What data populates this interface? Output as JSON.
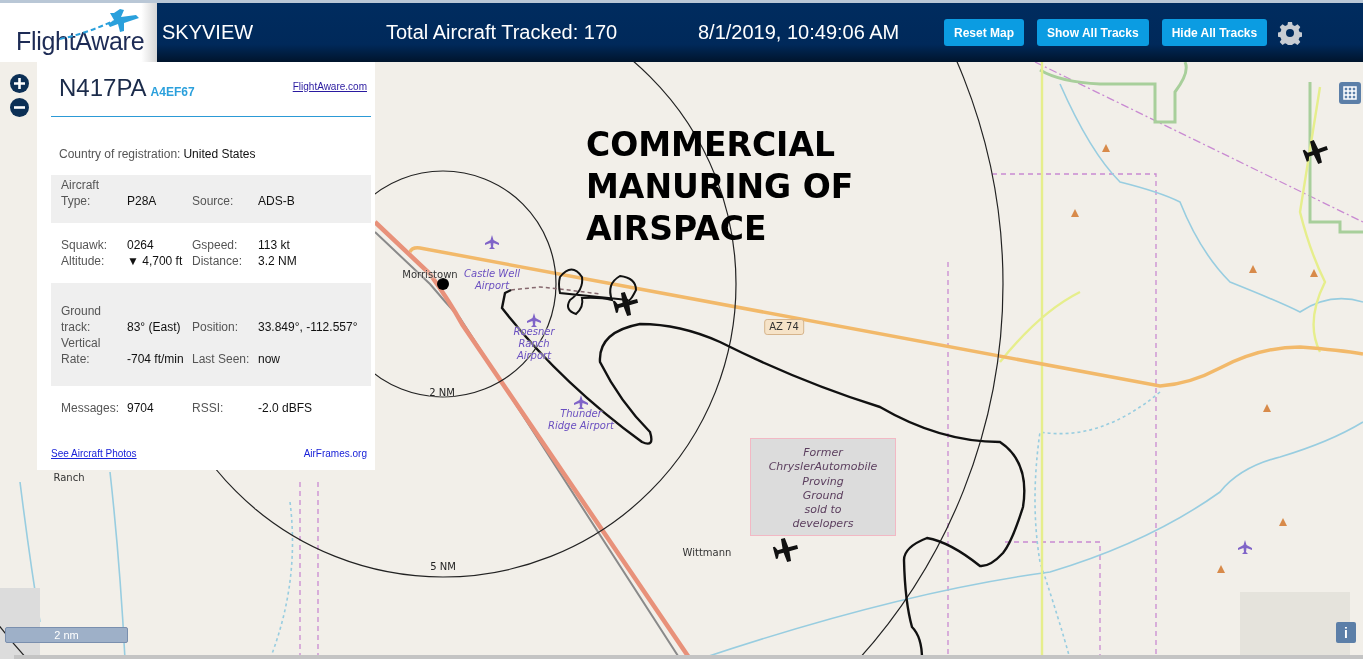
{
  "header": {
    "logo": "FlightAware",
    "title": "SKYVIEW",
    "aircraft_total": "Total Aircraft Tracked: 170",
    "datetime": "8/1/2019, 10:49:06 AM",
    "buttons": [
      "Reset Map",
      "Show All Tracks",
      "Hide All Tracks"
    ]
  },
  "aircraft_panel": {
    "registration": "N417PA",
    "hex": "A4EF67",
    "site_link": "FlightAware.com",
    "country_label": "Country of registration:",
    "country": "United States",
    "sections": [
      {
        "shaded": true,
        "fields": [
          {
            "label": "Aircraft Type:",
            "value": "P28A"
          },
          {
            "label": "Source:",
            "value": "ADS-B"
          }
        ]
      },
      {
        "shaded": false,
        "fields": [
          {
            "label": "Squawk:",
            "value": "0264"
          },
          {
            "label": "Gspeed:",
            "value": "113 kt"
          },
          {
            "label": "Altitude:",
            "value": "▼ 4,700 ft"
          },
          {
            "label": "Distance:",
            "value": "3.2 NM"
          }
        ]
      },
      {
        "shaded": true,
        "fields": [
          {
            "label": "Ground track:",
            "value": "83° (East)"
          },
          {
            "label": "Position:",
            "value": "33.849°, -112.557°"
          },
          {
            "label": "Vertical Rate:",
            "value": "-704 ft/min"
          },
          {
            "label": "Last Seen:",
            "value": "now"
          }
        ]
      },
      {
        "shaded": false,
        "fields": [
          {
            "label": "Messages:",
            "value": "9704"
          },
          {
            "label": "RSSI:",
            "value": "-2.0 dBFS"
          }
        ]
      }
    ],
    "photos_link": "See Aircraft Photos",
    "airframes_link": "AirFrames.org"
  },
  "map": {
    "labels": [
      {
        "kind": "place",
        "lines": [
          "Morristown"
        ]
      },
      {
        "kind": "airport",
        "lines": [
          "Castle Well",
          "Airport"
        ]
      },
      {
        "kind": "airport",
        "lines": [
          "Roesner",
          "Ranch",
          "Airport"
        ]
      },
      {
        "kind": "airport",
        "lines": [
          "Thunder",
          "Ridge Airport"
        ]
      },
      {
        "kind": "road",
        "lines": [
          "AZ 74"
        ]
      },
      {
        "kind": "ring",
        "lines": [
          "2 NM"
        ]
      },
      {
        "kind": "ring",
        "lines": [
          "5 NM"
        ]
      },
      {
        "kind": "area",
        "lines": [
          "Former",
          "ChryslerAutomobile",
          "Proving",
          "Ground",
          "sold to",
          "developers"
        ]
      },
      {
        "kind": "place",
        "lines": [
          "Wittmann"
        ]
      },
      {
        "kind": "place",
        "lines": [
          "Ranch"
        ]
      }
    ],
    "annotation": [
      "COMMERCIAL",
      "MANURING OF",
      "AIRSPACE"
    ],
    "scale": "2 nm",
    "info_button": "i"
  }
}
